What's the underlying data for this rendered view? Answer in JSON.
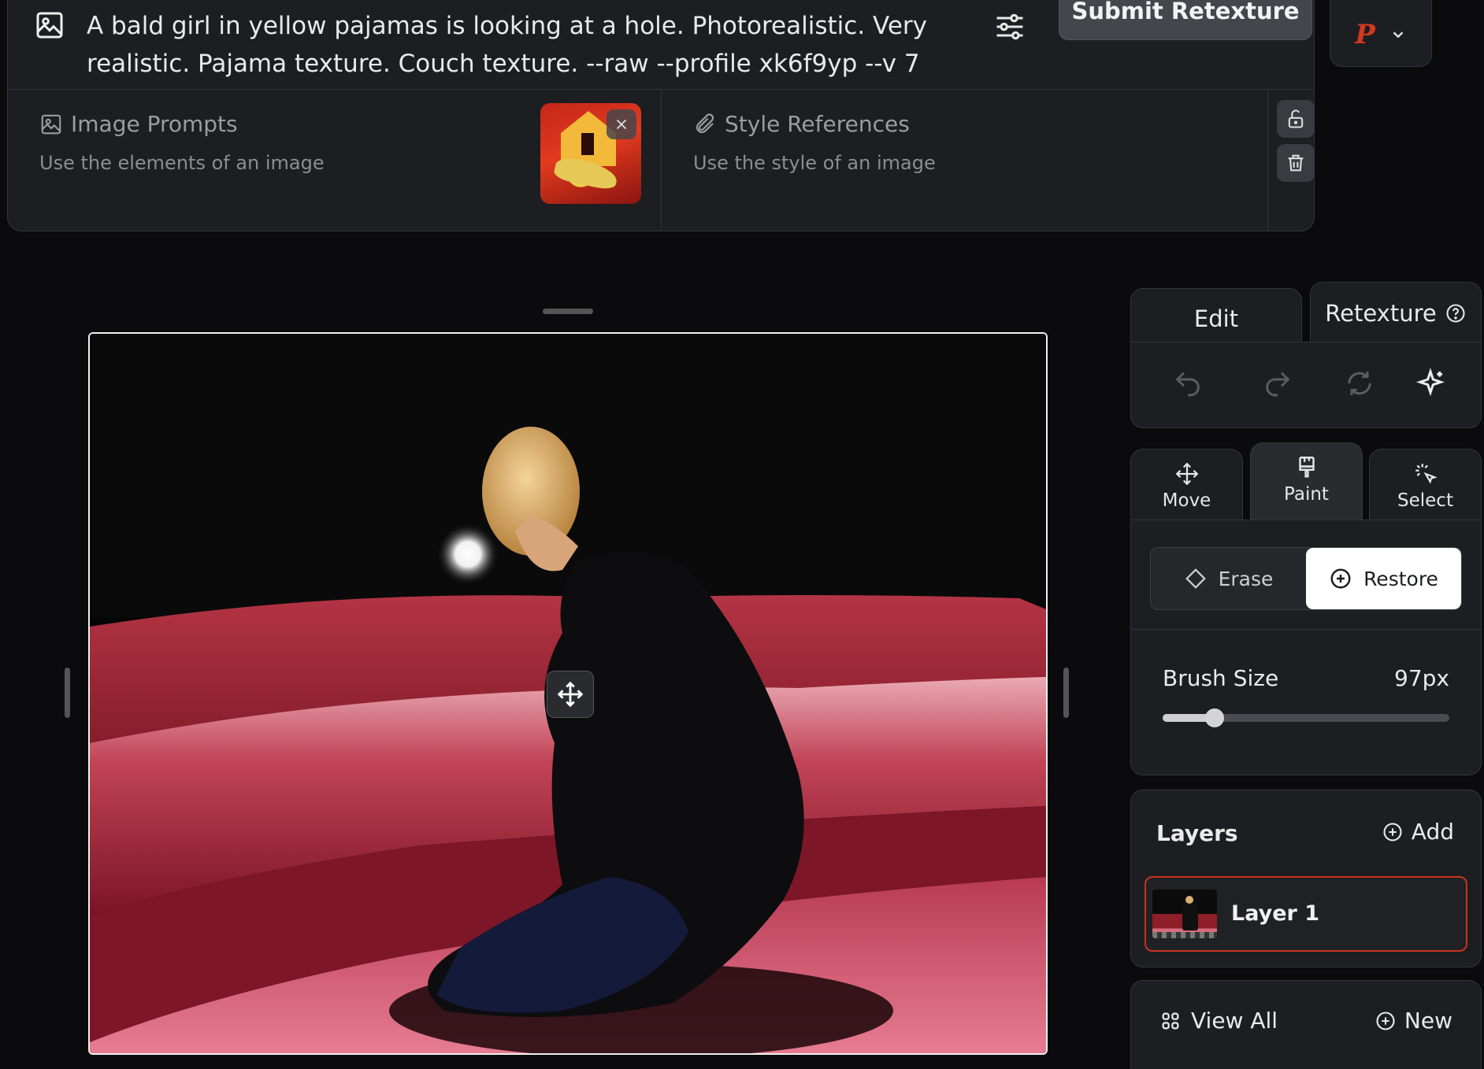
{
  "prompt": {
    "text": "A bald girl in yellow pajamas is looking at a hole. Photorealistic. Very realistic. Pajama texture. Couch texture. --raw --profile xk6f9yp --v 7",
    "submit_label": "Submit Retexture"
  },
  "image_prompts": {
    "title": "Image Prompts",
    "subtitle": "Use the elements of an image"
  },
  "style_references": {
    "title": "Style References",
    "subtitle": "Use the style of an image"
  },
  "profile": {
    "letter": "P"
  },
  "tabs": {
    "edit": "Edit",
    "retexture": "Retexture"
  },
  "tools": [
    {
      "label": "Move",
      "icon": "move-icon"
    },
    {
      "label": "Paint",
      "icon": "paintbrush-icon"
    },
    {
      "label": "Select",
      "icon": "magic-select-icon"
    }
  ],
  "paint": {
    "erase_label": "Erase",
    "restore_label": "Restore",
    "active_mode": "Restore",
    "brush_label": "Brush Size",
    "brush_value": "97px",
    "brush_fraction": 0.18
  },
  "layers": {
    "title": "Layers",
    "add_label": "Add",
    "items": [
      {
        "name": "Layer 1"
      }
    ]
  },
  "gallery": {
    "view_all_label": "View All",
    "new_label": "New"
  },
  "colors": {
    "accent_red": "#c8331f",
    "panel_bg": "#1d1e21",
    "page_bg": "#0b0b0d"
  }
}
